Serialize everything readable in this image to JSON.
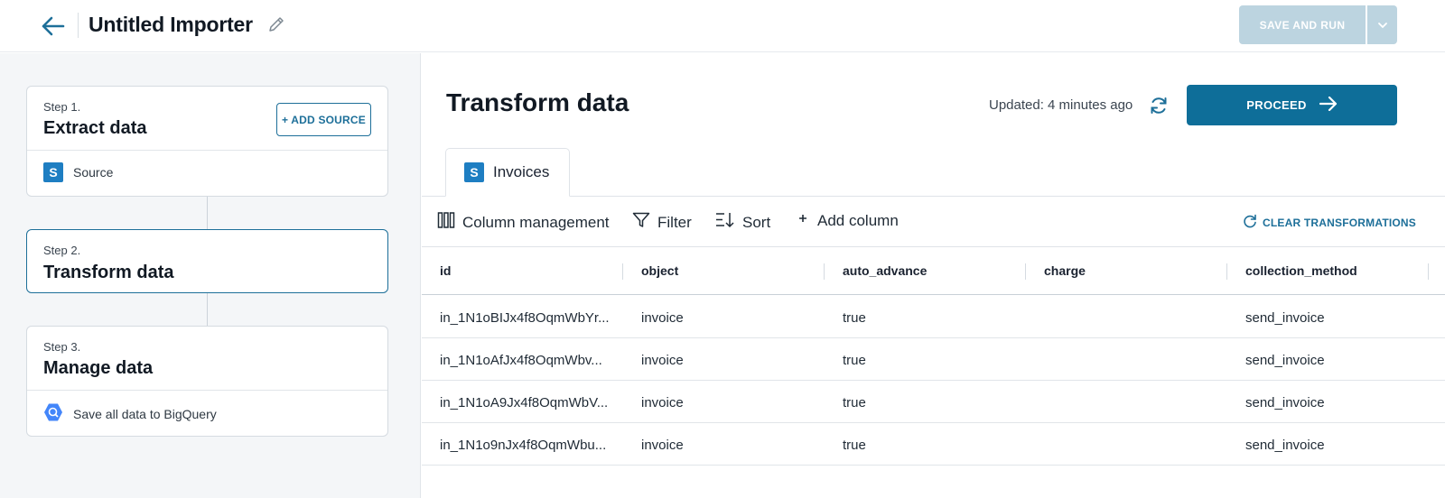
{
  "header": {
    "title": "Untitled Importer",
    "save_run_label": "SAVE AND RUN"
  },
  "steps": [
    {
      "label": "Step 1.",
      "title": "Extract data",
      "action": "+ ADD SOURCE",
      "item": "Source"
    },
    {
      "label": "Step 2.",
      "title": "Transform data"
    },
    {
      "label": "Step 3.",
      "title": "Manage data",
      "item": "Save all data to BigQuery"
    }
  ],
  "main": {
    "title": "Transform data",
    "updated": "Updated: 4 minutes ago",
    "proceed_label": "PROCEED",
    "tab_label": "Invoices",
    "source_glyph": "S"
  },
  "toolbar": {
    "column_management": "Column management",
    "filter": "Filter",
    "sort": "Sort",
    "add_column": "Add column",
    "clear": "CLEAR TRANSFORMATIONS"
  },
  "table": {
    "columns": [
      "id",
      "object",
      "auto_advance",
      "charge",
      "collection_method"
    ],
    "rows": [
      [
        "in_1N1oBIJx4f8OqmWbYr...",
        "invoice",
        "true",
        "",
        "send_invoice"
      ],
      [
        "in_1N1oAfJx4f8OqmWbv...",
        "invoice",
        "true",
        "",
        "send_invoice"
      ],
      [
        "in_1N1oA9Jx4f8OqmWbV...",
        "invoice",
        "true",
        "",
        "send_invoice"
      ],
      [
        "in_1N1o9nJx4f8OqmWbu...",
        "invoice",
        "true",
        "",
        "send_invoice"
      ]
    ]
  },
  "colors": {
    "accent": "#0e6e99",
    "disabled_button": "#bcd4e0",
    "stripe_icon": "#1e7ec2",
    "bigquery_icon": "#4386fa"
  }
}
